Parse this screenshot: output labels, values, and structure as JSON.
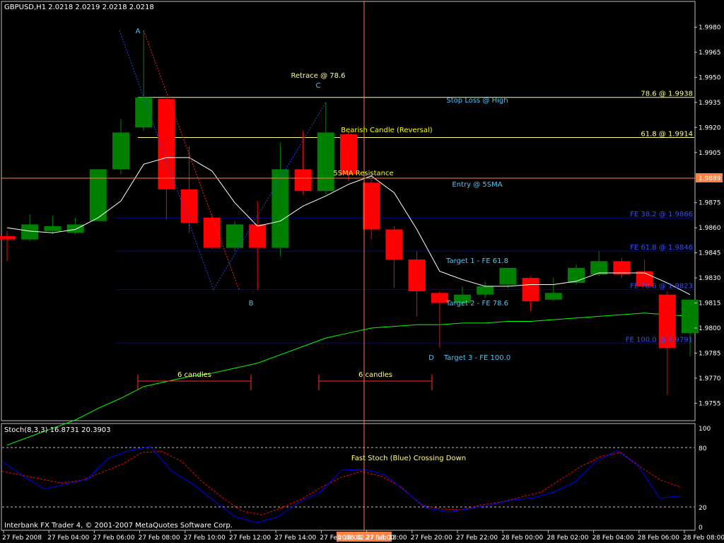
{
  "window": {
    "symbol_header": "GBPUSD,H1  2.0218 2.0219 2.0218 2.0218",
    "footer": "Interbank FX Trader 4, © 2001-2007 MetaQuotes Software Corp.",
    "current_price": "1.9889",
    "crosshair_time": "2008.02.27 18:00"
  },
  "colors": {
    "background": "#000000",
    "bull": "#008000",
    "bear": "#ff0000",
    "grid": "#c0c0c0",
    "sma5": "#ffffff",
    "sma_long": "#00ff00",
    "fib_yellow": "#ffff80",
    "fe_blue": "#0000c0",
    "label_cyan": "#4fc3f7",
    "stoch_fast": "#0000ff",
    "stoch_slow": "#ff0000",
    "crosshair": "#ff8040"
  },
  "chart_data": [
    {
      "type": "candlestick",
      "title": "GBPUSD,H1",
      "ylim": [
        1.9745,
        1.9995
      ],
      "y_ticks": [
        "1.9980",
        "1.9965",
        "1.9950",
        "1.9935",
        "1.9920",
        "1.9905",
        "1.9889",
        "1.9875",
        "1.9860",
        "1.9845",
        "1.9830",
        "1.9815",
        "1.9800",
        "1.9785",
        "1.9770",
        "1.9755"
      ],
      "x_ticks": [
        "27 Feb 2008",
        "27 Feb 04:00",
        "27 Feb 06:00",
        "27 Feb 08:00",
        "27 Feb 10:00",
        "27 Feb 12:00",
        "27 Feb 14:00",
        "27 Feb 16:00",
        "27 Feb 18:00",
        "27 Feb 20:00",
        "27 Feb 22:00",
        "28 Feb 00:00",
        "28 Feb 02:00",
        "28 Feb 04:00",
        "28 Feb 06:00",
        "28 Feb 08:00"
      ],
      "candles": [
        {
          "o": 1.9855,
          "h": 1.9858,
          "l": 1.984,
          "c": 1.9853
        },
        {
          "o": 1.9853,
          "h": 1.9868,
          "l": 1.9852,
          "c": 1.9862
        },
        {
          "o": 1.9858,
          "h": 1.9867,
          "l": 1.9856,
          "c": 1.9861
        },
        {
          "o": 1.9857,
          "h": 1.9866,
          "l": 1.9856,
          "c": 1.9862
        },
        {
          "o": 1.9864,
          "h": 1.9895,
          "l": 1.9864,
          "c": 1.9895
        },
        {
          "o": 1.9895,
          "h": 1.9925,
          "l": 1.9892,
          "c": 1.9917
        },
        {
          "o": 1.992,
          "h": 1.9978,
          "l": 1.9918,
          "c": 1.9938
        },
        {
          "o": 1.9937,
          "h": 1.9938,
          "l": 1.9865,
          "c": 1.9883
        },
        {
          "o": 1.9883,
          "h": 1.9909,
          "l": 1.9857,
          "c": 1.9863
        },
        {
          "o": 1.9866,
          "h": 1.9868,
          "l": 1.9847,
          "c": 1.9848
        },
        {
          "o": 1.9848,
          "h": 1.9864,
          "l": 1.9846,
          "c": 1.9862
        },
        {
          "o": 1.9862,
          "h": 1.9876,
          "l": 1.9823,
          "c": 1.9848
        },
        {
          "o": 1.9848,
          "h": 1.9911,
          "l": 1.9843,
          "c": 1.9895
        },
        {
          "o": 1.9895,
          "h": 1.9918,
          "l": 1.988,
          "c": 1.9882
        },
        {
          "o": 1.9882,
          "h": 1.9935,
          "l": 1.988,
          "c": 1.9917
        },
        {
          "o": 1.9916,
          "h": 1.9918,
          "l": 1.9888,
          "c": 1.9892
        },
        {
          "o": 1.9887,
          "h": 1.9889,
          "l": 1.9853,
          "c": 1.9859
        },
        {
          "o": 1.9859,
          "h": 1.9861,
          "l": 1.9824,
          "c": 1.9841
        },
        {
          "o": 1.9841,
          "h": 1.9846,
          "l": 1.9807,
          "c": 1.9822
        },
        {
          "o": 1.9821,
          "h": 1.9822,
          "l": 1.9788,
          "c": 1.9815
        },
        {
          "o": 1.9815,
          "h": 1.9825,
          "l": 1.9813,
          "c": 1.982
        },
        {
          "o": 1.982,
          "h": 1.9828,
          "l": 1.9818,
          "c": 1.9825
        },
        {
          "o": 1.9826,
          "h": 1.9836,
          "l": 1.9824,
          "c": 1.9836
        },
        {
          "o": 1.983,
          "h": 1.9831,
          "l": 1.981,
          "c": 1.9816
        },
        {
          "o": 1.9817,
          "h": 1.983,
          "l": 1.9816,
          "c": 1.9821
        },
        {
          "o": 1.9827,
          "h": 1.9838,
          "l": 1.9826,
          "c": 1.9836
        },
        {
          "o": 1.9832,
          "h": 1.9846,
          "l": 1.9831,
          "c": 1.984
        },
        {
          "o": 1.984,
          "h": 1.9842,
          "l": 1.983,
          "c": 1.9832
        },
        {
          "o": 1.9834,
          "h": 1.9841,
          "l": 1.9825,
          "c": 1.9825
        },
        {
          "o": 1.982,
          "h": 1.9822,
          "l": 1.976,
          "c": 1.9788
        },
        {
          "o": 1.9797,
          "h": 1.9817,
          "l": 1.9783,
          "c": 1.9817
        }
      ],
      "sma5": [
        1.986,
        1.9858,
        1.9857,
        1.9859,
        1.9866,
        1.9876,
        1.9898,
        1.9902,
        1.9902,
        1.9894,
        1.9875,
        1.9861,
        1.9864,
        1.9873,
        1.9879,
        1.9886,
        1.9891,
        1.9881,
        1.9859,
        1.9834,
        1.9829,
        1.9825,
        1.9825,
        1.9826,
        1.9826,
        1.9828,
        1.9833,
        1.9833,
        1.9833,
        1.9827,
        1.982
      ],
      "sma_long": [
        1.973,
        1.9735,
        1.974,
        1.9745,
        1.9752,
        1.9758,
        1.9765,
        1.9768,
        1.9771,
        1.9773,
        1.9776,
        1.9779,
        1.9784,
        1.9789,
        1.9794,
        1.9797,
        1.98,
        1.9801,
        1.9802,
        1.9802,
        1.9803,
        1.9803,
        1.9804,
        1.9804,
        1.9805,
        1.9806,
        1.9807,
        1.9808,
        1.9809,
        1.9808,
        1.9807
      ],
      "fib_levels": [
        {
          "price": 1.9938,
          "label": "78.6 @ 1.9938",
          "color": "#ffff80"
        },
        {
          "price": 1.9914,
          "label": "61.8 @ 1.9914",
          "color": "#ffff80"
        },
        {
          "price": 1.9866,
          "label": "FE 38.2 @ 1.9866",
          "color": "#0000c0"
        },
        {
          "price": 1.9846,
          "label": "FE 61.8 @ 1.9846",
          "color": "#0000c0"
        },
        {
          "price": 1.9823,
          "label": "FE 78.6 @ 1.9823",
          "color": "#0000c0"
        },
        {
          "price": 1.9791,
          "label": "FE 100.0 @ 1.9791",
          "color": "#0000c0"
        }
      ],
      "annotations": [
        {
          "text": "A",
          "price": 1.9978,
          "color": "#4fc3f7"
        },
        {
          "text": "B",
          "price": 1.9815,
          "color": "#4fc3f7"
        },
        {
          "text": "C",
          "price": 1.9945,
          "color": "#4fc3f7"
        },
        {
          "text": "D",
          "price": 1.9785,
          "color": "#4fc3f7"
        },
        {
          "text": "Retrace @ 78.6",
          "color": "#ffff80"
        },
        {
          "text": "Stop Loss @ High",
          "color": "#4fc3f7"
        },
        {
          "text": "Bearish Candle (Reversal)",
          "color": "#ffff00"
        },
        {
          "text": "5SMA Resistance",
          "color": "#ffff00"
        },
        {
          "text": "Entry @ 5SMA",
          "color": "#4fc3f7"
        },
        {
          "text": "Target 1 - FE 61.8",
          "color": "#4fc3f7"
        },
        {
          "text": "Target 2 - FE 78.6",
          "color": "#4fc3f7"
        },
        {
          "text": "Target 3 - FE 100.0",
          "color": "#4fc3f7"
        },
        {
          "text": "6 candles",
          "color": "#ffff80"
        },
        {
          "text": "6 candles",
          "color": "#ffff80"
        }
      ]
    },
    {
      "type": "line",
      "title": "Stoch(8,3,3) 16.8731 20.3903",
      "ylim": [
        0,
        100
      ],
      "y_ticks": [
        "100",
        "80",
        "20",
        "0"
      ],
      "levels": [
        80,
        20
      ],
      "series": [
        {
          "name": "fast",
          "values": [
            66,
            51,
            38,
            43,
            48,
            69,
            77,
            81,
            56,
            43,
            26,
            10,
            4,
            10,
            25,
            35,
            57,
            58,
            53,
            36,
            19,
            15,
            18,
            22,
            27,
            29,
            35,
            45,
            66,
            77,
            61,
            29,
            31
          ]
        },
        {
          "name": "slow",
          "values": [
            56,
            52,
            48,
            44,
            47,
            55,
            63,
            75,
            76,
            66,
            46,
            30,
            16,
            12,
            19,
            28,
            40,
            50,
            56,
            51,
            40,
            22,
            18,
            17,
            22,
            25,
            30,
            35,
            48,
            61,
            71,
            75,
            60,
            47,
            40
          ]
        }
      ],
      "annotation": "Fast Stoch (Blue) Crossing Down"
    }
  ]
}
